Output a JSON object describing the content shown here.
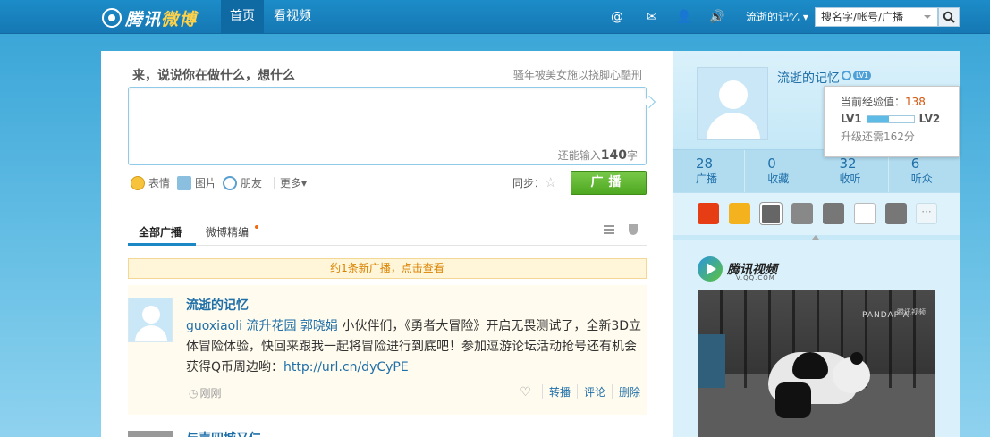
{
  "topbar": {
    "logo": {
      "brand": "腾讯",
      "highlight": "微博"
    },
    "nav": {
      "home": "首页",
      "video": "看视频"
    },
    "icons": [
      "at-icon",
      "mail-icon",
      "user-icon",
      "speaker-icon"
    ],
    "user_menu": "流逝的记忆",
    "search": {
      "value": "搜名字/帐号/广播"
    }
  },
  "composer": {
    "title": "来，说说你在做什么，想什么",
    "hint": "骚年被美女施以挠脚心酷刑",
    "count_prefix": "还能输入",
    "count_value": "140",
    "count_suffix": "字",
    "tools": {
      "emoji": "表情",
      "image": "图片",
      "friend": "朋友",
      "more": "更多"
    },
    "sync_label": "同步：",
    "post_button": "广播"
  },
  "tabs": {
    "all": "全部广播",
    "picks": "微博精编"
  },
  "notice": "约1条新广播，点击查看",
  "feed": {
    "item": {
      "author": "流逝的记忆",
      "mention": "guoxiaoli",
      "mention2": "流升花园",
      "mention3": "郭晓娟",
      "text": "小伙伴们，《勇者大冒险》开启无畏测试了，全新3D立体冒险体验，快回来跟我一起将冒险进行到底吧！参加逗游论坛活动抢号还有机会获得Q币周边哟：",
      "link": "http://url.cn/dyCyPE",
      "time": "刚刚",
      "actions": {
        "repost": "转播",
        "comment": "评论",
        "delete": "删除"
      }
    },
    "next_author": "与声四城又仁"
  },
  "sidebar": {
    "profile": {
      "name": "流逝的记忆",
      "level_badge": "LV1"
    },
    "stats": [
      {
        "num": "28",
        "label": "广播"
      },
      {
        "num": "0",
        "label": "收藏"
      },
      {
        "num": "32",
        "label": "收听"
      },
      {
        "num": "6",
        "label": "听众"
      }
    ],
    "level_popup": {
      "exp_label": "当前经验值：",
      "exp_value": "138",
      "from_level": "LV1",
      "to_level": "LV2",
      "progress_fraction": 0.46,
      "remaining": "升级还需162分"
    },
    "apps_more": "···",
    "video": {
      "brand": "腾讯视频",
      "domain": "V.QQ.COM",
      "overlay": "PANDAPIA",
      "watermark": "腾讯视频"
    }
  }
}
